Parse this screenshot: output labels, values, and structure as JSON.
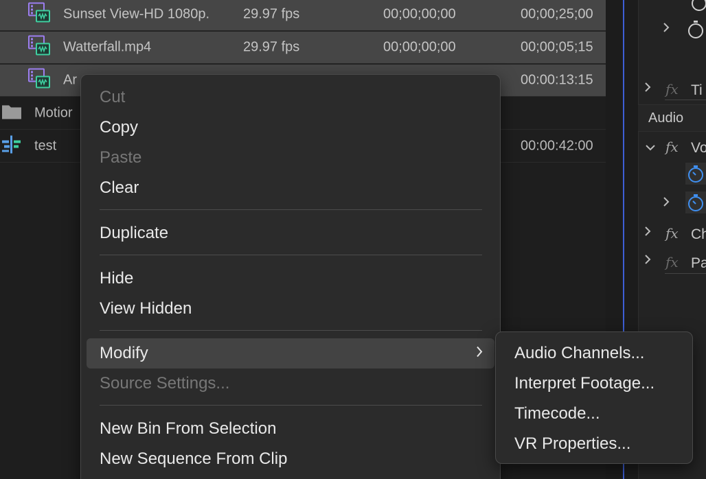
{
  "project": {
    "items": [
      {
        "name": "Sunset View-HD 1080p.",
        "fps": "29.97 fps",
        "start": "00;00;00;00",
        "duration": "00;00;25;00",
        "type": "clip",
        "selected": true
      },
      {
        "name": "Watterfall.mp4",
        "fps": "29.97 fps",
        "start": "00;00;00;00",
        "duration": "00;00;05;15",
        "type": "clip",
        "selected": true
      },
      {
        "name": "Ar",
        "fps": "",
        "start": "",
        "duration": "00:00:13:15",
        "type": "clip",
        "selected": true
      },
      {
        "name": "Motior",
        "fps": "",
        "start": "",
        "duration": "",
        "type": "bin",
        "selected": false
      },
      {
        "name": "test",
        "fps": "",
        "start": "",
        "duration": "00:00:42:00",
        "type": "sequence",
        "selected": false
      }
    ]
  },
  "effects": {
    "audio_header": "Audio",
    "items": [
      {
        "fx_label": "Ti",
        "dim": true
      },
      {
        "fx_label": "Vo",
        "dim": false
      },
      {
        "fx_label": "Ch",
        "dim": false
      },
      {
        "fx_label": "Pa",
        "dim": true
      }
    ]
  },
  "context_menu": {
    "items": [
      {
        "label": "Cut",
        "disabled": true
      },
      {
        "label": "Copy",
        "disabled": false
      },
      {
        "label": "Paste",
        "disabled": true
      },
      {
        "label": "Clear",
        "disabled": false
      },
      {
        "label": "Duplicate",
        "disabled": false
      },
      {
        "label": "Hide",
        "disabled": false
      },
      {
        "label": "View Hidden",
        "disabled": false
      },
      {
        "label": "Modify",
        "disabled": false,
        "highlighted": true,
        "has_submenu": true
      },
      {
        "label": "Source Settings...",
        "disabled": true
      },
      {
        "label": "New Bin From Selection",
        "disabled": false
      },
      {
        "label": "New Sequence From Clip",
        "disabled": false
      }
    ]
  },
  "submenu": {
    "items": [
      {
        "label": "Audio Channels..."
      },
      {
        "label": "Interpret Footage..."
      },
      {
        "label": "Timecode..."
      },
      {
        "label": "VR Properties..."
      }
    ]
  },
  "colors": {
    "clip_icon": "#9c7ef0",
    "clip_audio": "#3ed0a0",
    "sequence_icon": "#5aa0e8",
    "stopwatch_active": "#3f8ff0",
    "playhead": "#3d5fd6"
  }
}
